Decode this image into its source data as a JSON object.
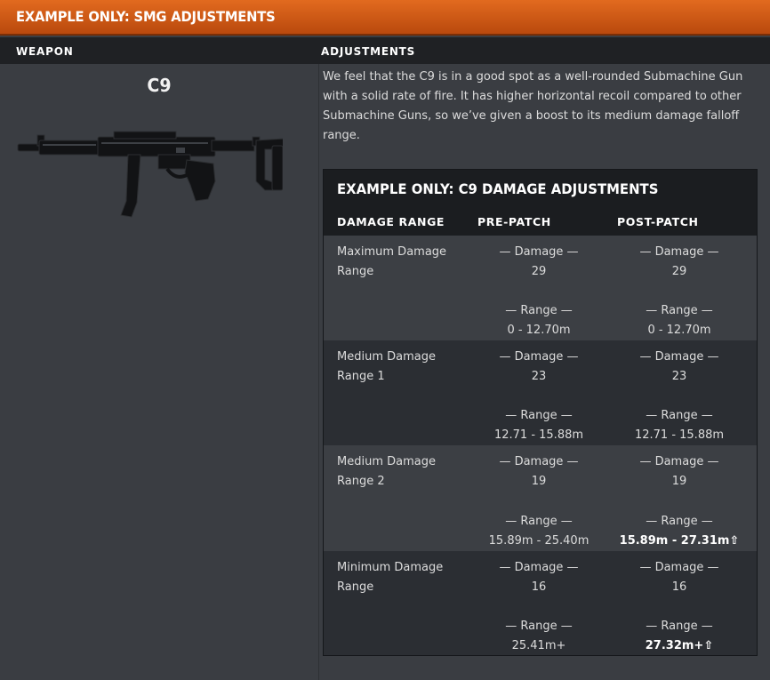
{
  "header": {
    "title": "EXAMPLE ONLY: SMG ADJUSTMENTS"
  },
  "columns": {
    "weapon": "WEAPON",
    "adjustments": "ADJUSTMENTS"
  },
  "weapon": {
    "name": "C9",
    "image_icon": "smg-rifle-icon"
  },
  "description": "We feel that the C9 is in a good spot as a well-rounded Submachine Gun with a solid rate of fire. It has higher horizontal recoil compared to other Submachine Guns, so we’ve given a boost to its medium damage falloff range.",
  "damage_table": {
    "title": "EXAMPLE ONLY: C9 DAMAGE ADJUSTMENTS",
    "headers": [
      "DAMAGE RANGE",
      "PRE-PATCH",
      "POST-PATCH"
    ],
    "damage_caption": "— Damage —",
    "range_caption": "— Range —",
    "rows": [
      {
        "label": "Maximum Damage Range",
        "pre": {
          "damage": "29",
          "range": "0 - 12.70m"
        },
        "post": {
          "damage": "29",
          "range": "0 - 12.70m"
        }
      },
      {
        "label": "Medium Damage Range 1",
        "pre": {
          "damage": "23",
          "range": "12.71 - 15.88m"
        },
        "post": {
          "damage": "23",
          "range": "12.71 - 15.88m"
        }
      },
      {
        "label": "Medium Damage Range 2",
        "pre": {
          "damage": "19",
          "range": "15.89m - 25.40m"
        },
        "post": {
          "damage": "19",
          "range": "15.89m - 27.31m⇧"
        }
      },
      {
        "label": "Minimum Damage Range",
        "pre": {
          "damage": "16",
          "range": "25.41m+"
        },
        "post": {
          "damage": "16",
          "range": "27.32m+⇧"
        }
      }
    ]
  },
  "colors": {
    "accent": "#d65d17",
    "panel": "#3a3d42",
    "dark": "#1f2124"
  }
}
